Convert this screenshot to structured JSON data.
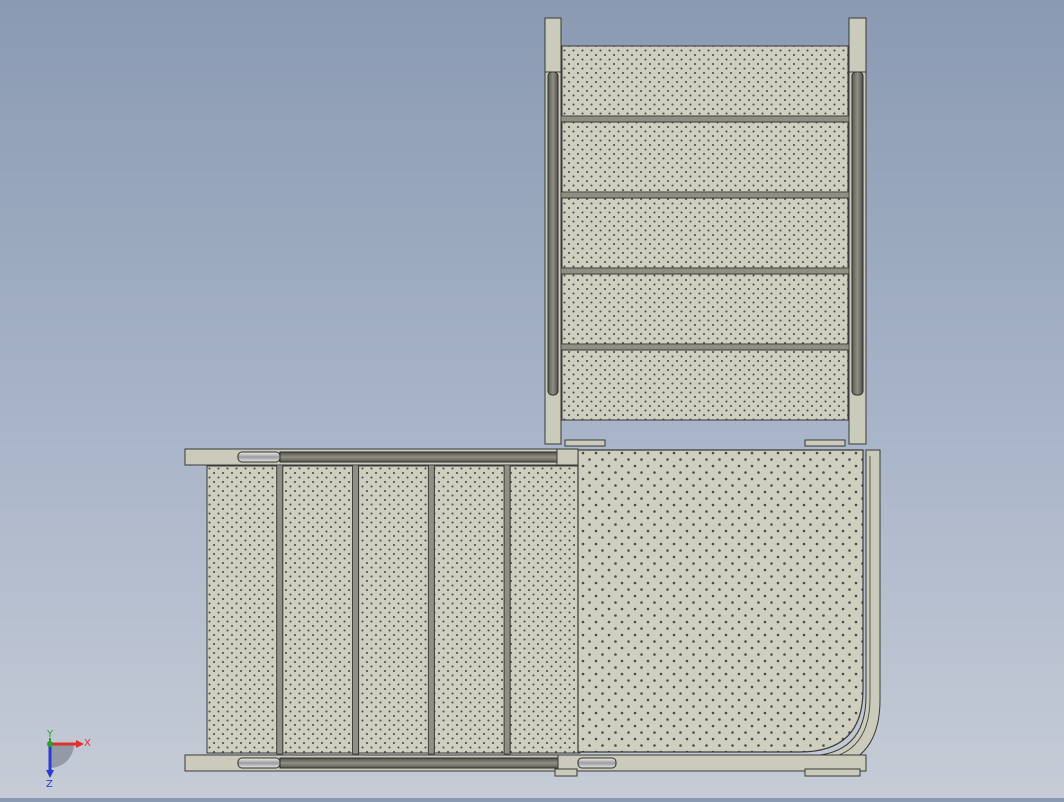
{
  "viewport": {
    "background_top": "#8a9ab2",
    "background_bottom": "#c6ccd6"
  },
  "model": {
    "tread_color": "#cfcfbf",
    "frame_color": "#cbcbbb",
    "edge_color": "#3a3a3a",
    "hole_color": "#4a4a44",
    "upper_flight_treads": 5,
    "lower_flight_treads": 5
  },
  "triad": {
    "x_label": "X",
    "y_label": "Y",
    "z_label": "Z",
    "x_color": "#e03030",
    "y_color": "#2aa02a",
    "z_color": "#2a3ad0"
  }
}
